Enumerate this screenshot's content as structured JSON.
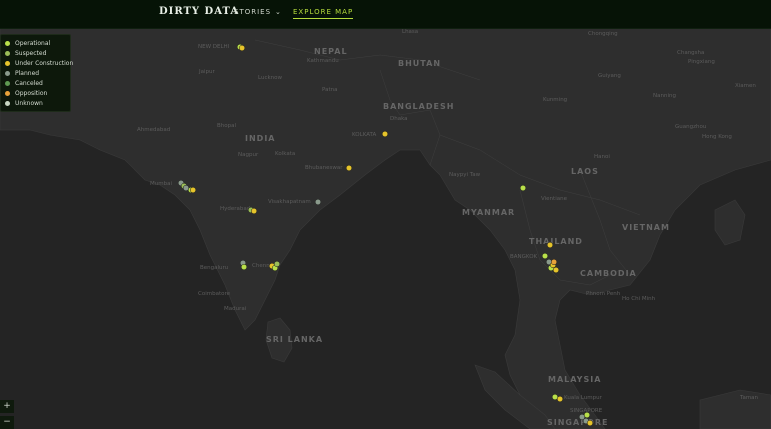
{
  "header": {
    "brand": "DIRTY DATA",
    "nav_stories": "STORIES",
    "nav_explore": "EXPLORE MAP"
  },
  "legend": [
    {
      "label": "Operational",
      "color": "#b9e04a"
    },
    {
      "label": "Suspected",
      "color": "#9bbe58"
    },
    {
      "label": "Under Construction",
      "color": "#e6c42b"
    },
    {
      "label": "Planned",
      "color": "#8a9a8c"
    },
    {
      "label": "Canceled",
      "color": "#5f9a52"
    },
    {
      "label": "Opposition",
      "color": "#e8a23a"
    },
    {
      "label": "Unknown",
      "color": "#c9d7c3"
    }
  ],
  "map": {
    "countries": [
      "NEPAL",
      "BHUTAN",
      "BANGLADESH",
      "INDIA",
      "MYANMAR",
      "LAOS",
      "THAILAND",
      "VIETNAM",
      "CAMBODIA",
      "SRI LANKA",
      "MALAYSIA",
      "SINGAPORE"
    ],
    "cities": [
      "NEW DELHI",
      "Lhasa",
      "Chongqing",
      "Changsha",
      "Pingxiang",
      "Jaipur",
      "Kathmandu",
      "Lucknow",
      "Patna",
      "Guiyang",
      "Kunming",
      "Nanning",
      "Xiamen",
      "Ahmedabad",
      "Bhopal",
      "Dhaka",
      "Guangzhou",
      "Hong Kong",
      "KOLKATA",
      "Nagpur",
      "Kolkata",
      "Hanoi",
      "Mumbai",
      "Hyderabad",
      "Bhubaneswar",
      "Naypyi Taw",
      "Vientiane",
      "Visakhapatnam",
      "Bengaluru",
      "Chennai",
      "BANGKOK",
      "Phnom Penh",
      "Ho Chi Minh",
      "Coimbatore",
      "Madurai",
      "Kuala Lumpur",
      "SINGAPORE",
      "Taman"
    ],
    "plants": [
      {
        "status": "Operational"
      },
      {
        "status": "Under Construction"
      },
      {
        "status": "Planned"
      },
      {
        "status": "Suspected"
      },
      {
        "status": "Operational"
      },
      {
        "status": "Under Construction"
      },
      {
        "status": "Planned"
      },
      {
        "status": "Suspected"
      },
      {
        "status": "Under Construction"
      },
      {
        "status": "Planned"
      },
      {
        "status": "Planned"
      },
      {
        "status": "Operational"
      },
      {
        "status": "Under Construction"
      },
      {
        "status": "Operational"
      },
      {
        "status": "Suspected"
      },
      {
        "status": "Under Construction"
      },
      {
        "status": "Under Construction"
      },
      {
        "status": "Operational"
      },
      {
        "status": "Under Construction"
      },
      {
        "status": "Operational"
      },
      {
        "status": "Planned"
      },
      {
        "status": "Operational"
      },
      {
        "status": "Under Construction"
      },
      {
        "status": "Under Construction"
      },
      {
        "status": "Opposition"
      },
      {
        "status": "Operational"
      },
      {
        "status": "Under Construction"
      },
      {
        "status": "Planned"
      },
      {
        "status": "Planned"
      },
      {
        "status": "Under Construction"
      },
      {
        "status": "Operational"
      }
    ]
  },
  "zoom": {
    "in": "+",
    "out": "−"
  }
}
